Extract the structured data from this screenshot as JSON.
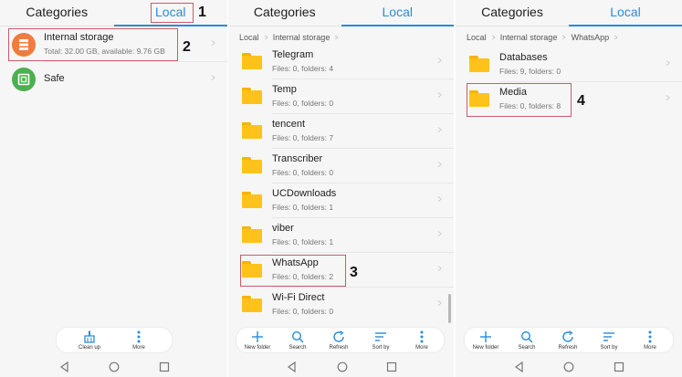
{
  "colors": {
    "accent": "#2a8bd8",
    "folder": "#ffc21a",
    "storage_icon": "#f07b3f",
    "safe_icon": "#4caf50",
    "highlight": "#c95c6a"
  },
  "tabs": {
    "categories": "Categories",
    "local": "Local"
  },
  "panel1": {
    "items": [
      {
        "title": "Internal storage",
        "sub": "Total: 32.00 GB, available: 9.76 GB",
        "icon": "storage-icon"
      },
      {
        "title": "Safe",
        "sub": "",
        "icon": "safe-icon"
      }
    ],
    "toolbar": [
      {
        "label": "Clean up",
        "icon": "broom-icon"
      },
      {
        "label": "More",
        "icon": "more-vertical-icon"
      }
    ]
  },
  "panel2": {
    "breadcrumb": [
      "Local",
      "Internal storage"
    ],
    "folders": [
      {
        "title": "Telegram",
        "sub": "Files: 0, folders: 4"
      },
      {
        "title": "Temp",
        "sub": "Files: 0, folders: 0"
      },
      {
        "title": "tencent",
        "sub": "Files: 0, folders: 7"
      },
      {
        "title": "Transcriber",
        "sub": "Files: 0, folders: 0"
      },
      {
        "title": "UCDownloads",
        "sub": "Files: 0, folders: 1"
      },
      {
        "title": "viber",
        "sub": "Files: 0, folders: 1"
      },
      {
        "title": "WhatsApp",
        "sub": "Files: 0, folders: 2"
      },
      {
        "title": "Wi-Fi Direct",
        "sub": "Files: 0, folders: 0"
      }
    ]
  },
  "panel3": {
    "breadcrumb": [
      "Local",
      "Internal storage",
      "WhatsApp"
    ],
    "folders": [
      {
        "title": "Databases",
        "sub": "Files: 9, folders: 0"
      },
      {
        "title": "Media",
        "sub": "Files: 0, folders: 8"
      }
    ]
  },
  "toolbar_full": [
    {
      "label": "New folder",
      "icon": "plus-icon"
    },
    {
      "label": "Search",
      "icon": "search-icon"
    },
    {
      "label": "Refresh",
      "icon": "refresh-icon"
    },
    {
      "label": "Sort by",
      "icon": "sort-icon"
    },
    {
      "label": "More",
      "icon": "more-vertical-icon"
    }
  ],
  "annotations": [
    "1",
    "2",
    "3",
    "4"
  ]
}
